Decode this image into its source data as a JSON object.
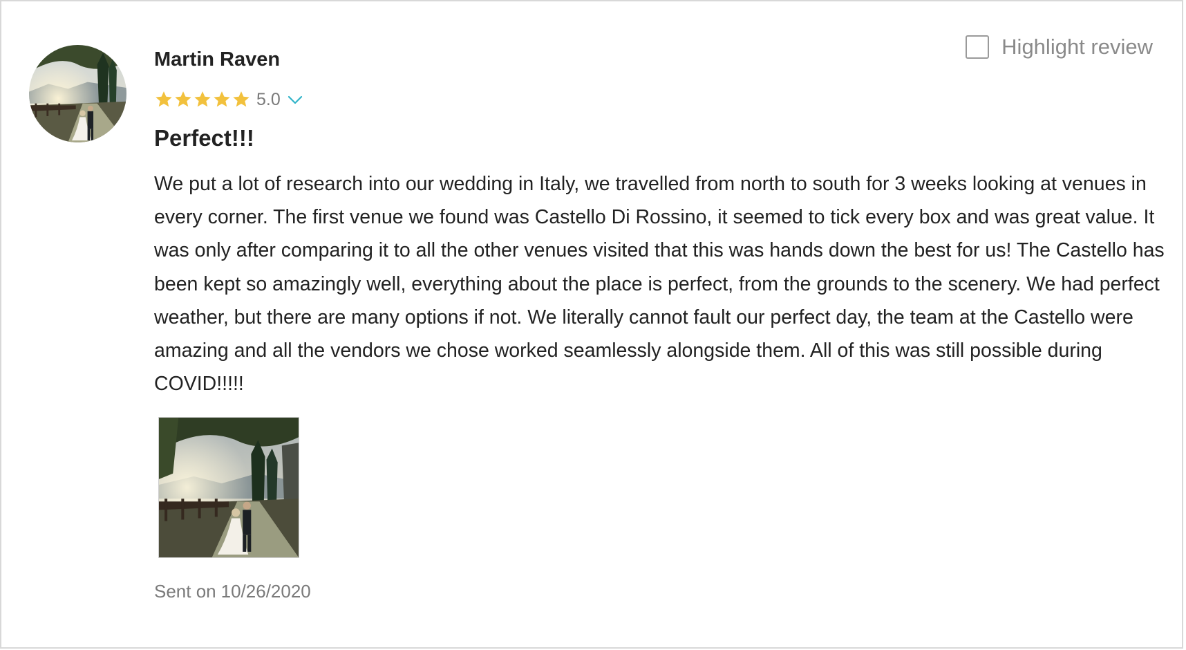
{
  "review": {
    "author_name": "Martin Raven",
    "rating": 5.0,
    "rating_label": "5.0",
    "stars_filled": 5,
    "stars_total": 5,
    "title": "Perfect!!!",
    "body": "We put a lot of research into our wedding in Italy, we travelled from north to south for 3 weeks looking at venues in every corner. The first venue we found was Castello Di Rossino, it seemed to tick every box and was great value. It was only after comparing it to all the other venues visited that this was hands down the best for us! The Castello has been kept so amazingly well, everything about the place is perfect, from the grounds to the scenery. We had perfect weather, but there are many options if not. We literally cannot fault our perfect day, the team at the Castello were amazing and all the vendors we chose worked seamlessly alongside them. All of this was still possible during COVID!!!!!",
    "sent_prefix": "Sent on",
    "sent_date": "10/26/2020",
    "photo_count": 1
  },
  "highlight": {
    "label": "Highlight review",
    "checked": false
  },
  "icons": {
    "star": "star-icon",
    "expand": "chevron-down-icon"
  },
  "colors": {
    "star": "#f2c13d",
    "chevron": "#2fb3c8",
    "muted_text": "#7a7a7a",
    "text": "#222222",
    "border": "#d8d8d8"
  }
}
